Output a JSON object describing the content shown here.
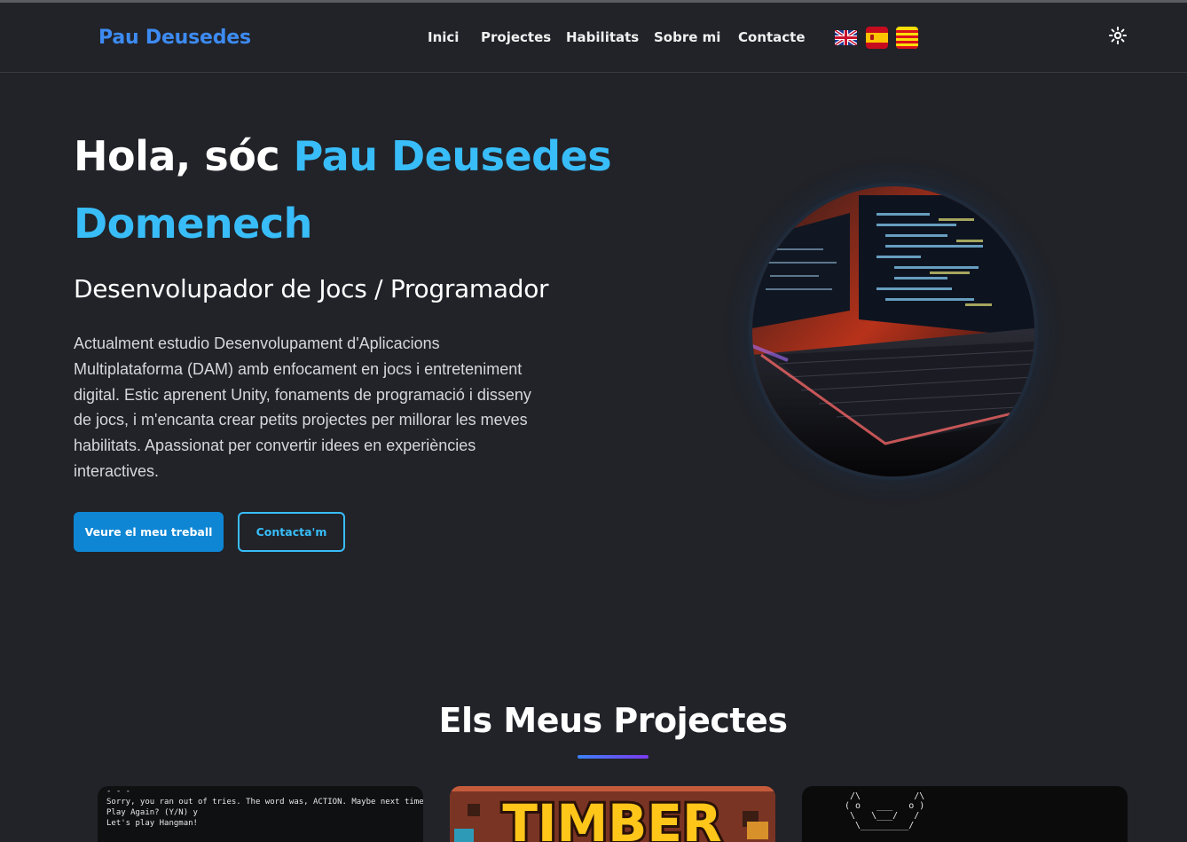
{
  "header": {
    "brand": "Pau Deusedes",
    "nav": [
      "Inici",
      "Projectes",
      "Habilitats",
      "Sobre mi",
      "Contacte"
    ],
    "languages": [
      {
        "code": "en",
        "icon": "uk-flag-icon"
      },
      {
        "code": "es",
        "icon": "spain-flag-icon"
      },
      {
        "code": "ca",
        "icon": "catalonia-flag-icon"
      }
    ],
    "theme_icon": "sun-icon"
  },
  "hero": {
    "greeting": "Hola, sóc ",
    "name": "Pau Deusedes Domenech",
    "subtitle": "Desenvolupador de Jocs / Programador",
    "description": "Actualment estudio Desenvolupament d'Aplicacions Multiplataforma (DAM) amb enfocament en jocs i entreteniment digital. Estic aprenent Unity, fonaments de programació i disseny de jocs, i m'encanta crear petits projectes per millorar les meves habilitats. Apassionat per convertir idees en experiències interactives.",
    "primary_button": "Veure el meu treball",
    "secondary_button": "Contacta'm"
  },
  "projects": {
    "title": "Els Meus Projectes",
    "cards": [
      {
        "terminal_lines": [
          "- - -",
          "",
          "Sorry, you ran out of tries. The word was, ACTION. Maybe next time!",
          "Play Again? (Y/N) y",
          "Let's play Hangman!"
        ]
      },
      {
        "logo_text": "TIMBER"
      },
      {
        "ascii_art": " /\\          /\\\n( o   ___   o )\n \\   \\___/   /\n  \\_________/"
      }
    ]
  },
  "colors": {
    "background": "#212329",
    "brand": "#3d8bf2",
    "accent": "#38bdf8",
    "primary_button": "#0e86d4"
  }
}
